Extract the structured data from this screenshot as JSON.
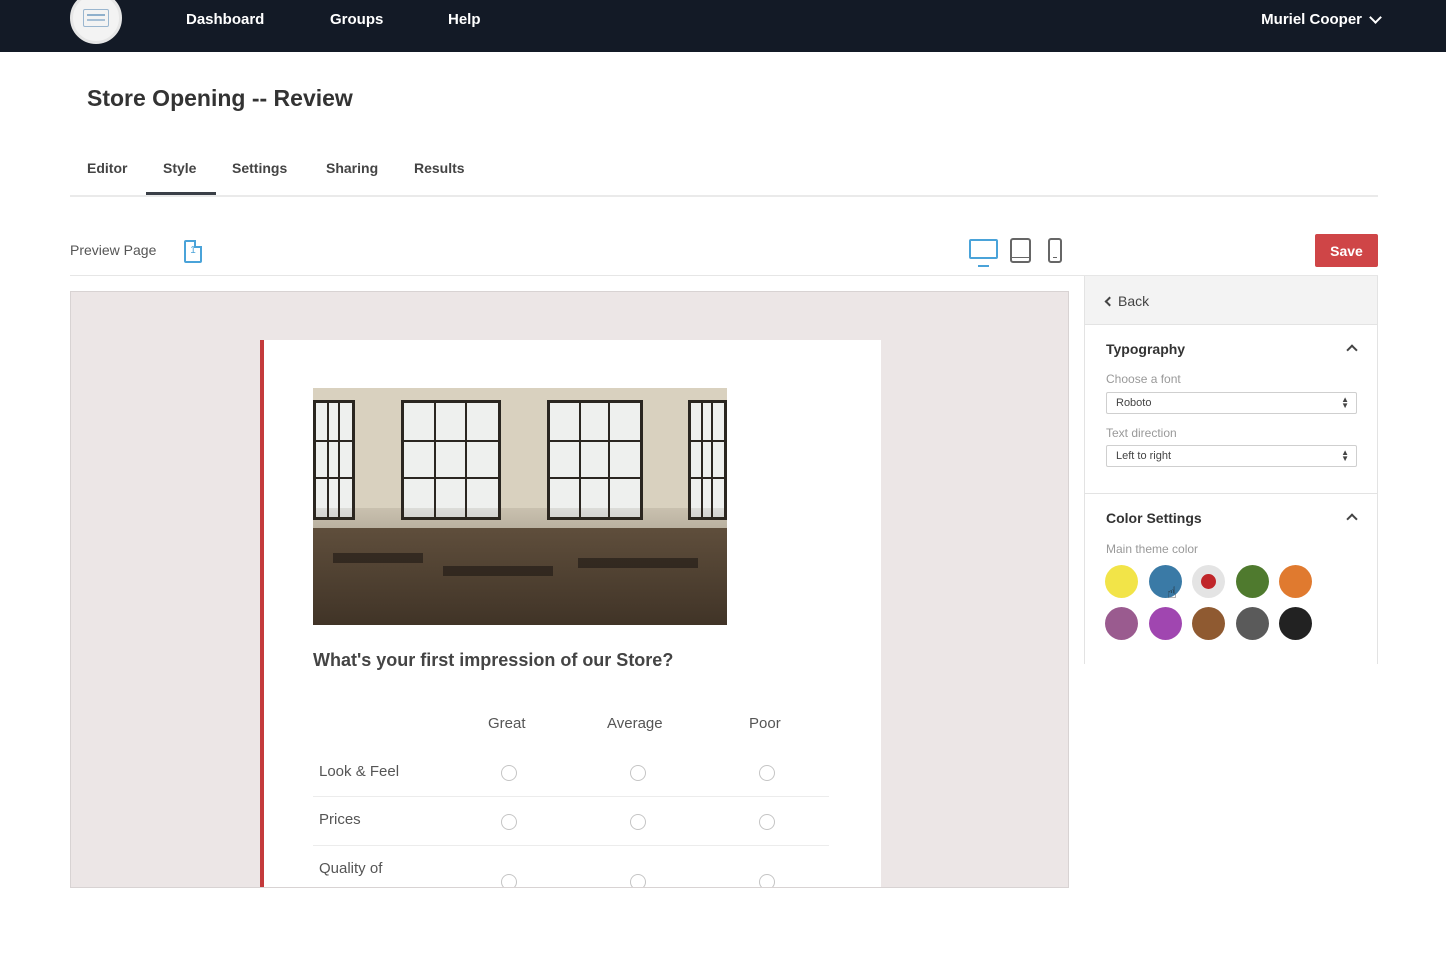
{
  "nav": {
    "links": [
      "Dashboard",
      "Groups",
      "Help"
    ],
    "user": "Muriel Cooper",
    "icons": {
      "logo": "app-logo",
      "user_menu": "chevron-down-icon"
    }
  },
  "page": {
    "title": "Store Opening -- Review"
  },
  "tabs": [
    {
      "label": "Editor"
    },
    {
      "label": "Style",
      "active": true
    },
    {
      "label": "Settings"
    },
    {
      "label": "Sharing"
    },
    {
      "label": "Results"
    }
  ],
  "toolbar": {
    "preview_label": "Preview Page",
    "page_icon": "page-icon",
    "page_icon_text": "1",
    "devices": [
      "desktop-icon",
      "tablet-icon",
      "phone-icon"
    ],
    "active_device": "desktop",
    "save_label": "Save",
    "save_color": "#cf4547"
  },
  "survey": {
    "accent_color": "#c43a3c",
    "image": "store-interior-photo",
    "question": "What's your first impression of our Store?",
    "columns": [
      "Great",
      "Average",
      "Poor"
    ],
    "rows": [
      "Look & Feel",
      "Prices",
      "Quality of"
    ]
  },
  "panel": {
    "back_label": "Back",
    "typography": {
      "title": "Typography",
      "font_label": "Choose a font",
      "font_value": "Roboto",
      "direction_label": "Text direction",
      "direction_value": "Left to right"
    },
    "colors": {
      "title": "Color Settings",
      "theme_label": "Main theme color",
      "swatches": [
        "#f2e448",
        "#3a7aa6",
        "#e4e4e4",
        "#4f7a2e",
        "#e07a2f",
        "#9a5b8f",
        "#a046b0",
        "#8f5a31",
        "#5a5a5a",
        "#222222"
      ],
      "selected_dot": "#c0262a"
    }
  }
}
